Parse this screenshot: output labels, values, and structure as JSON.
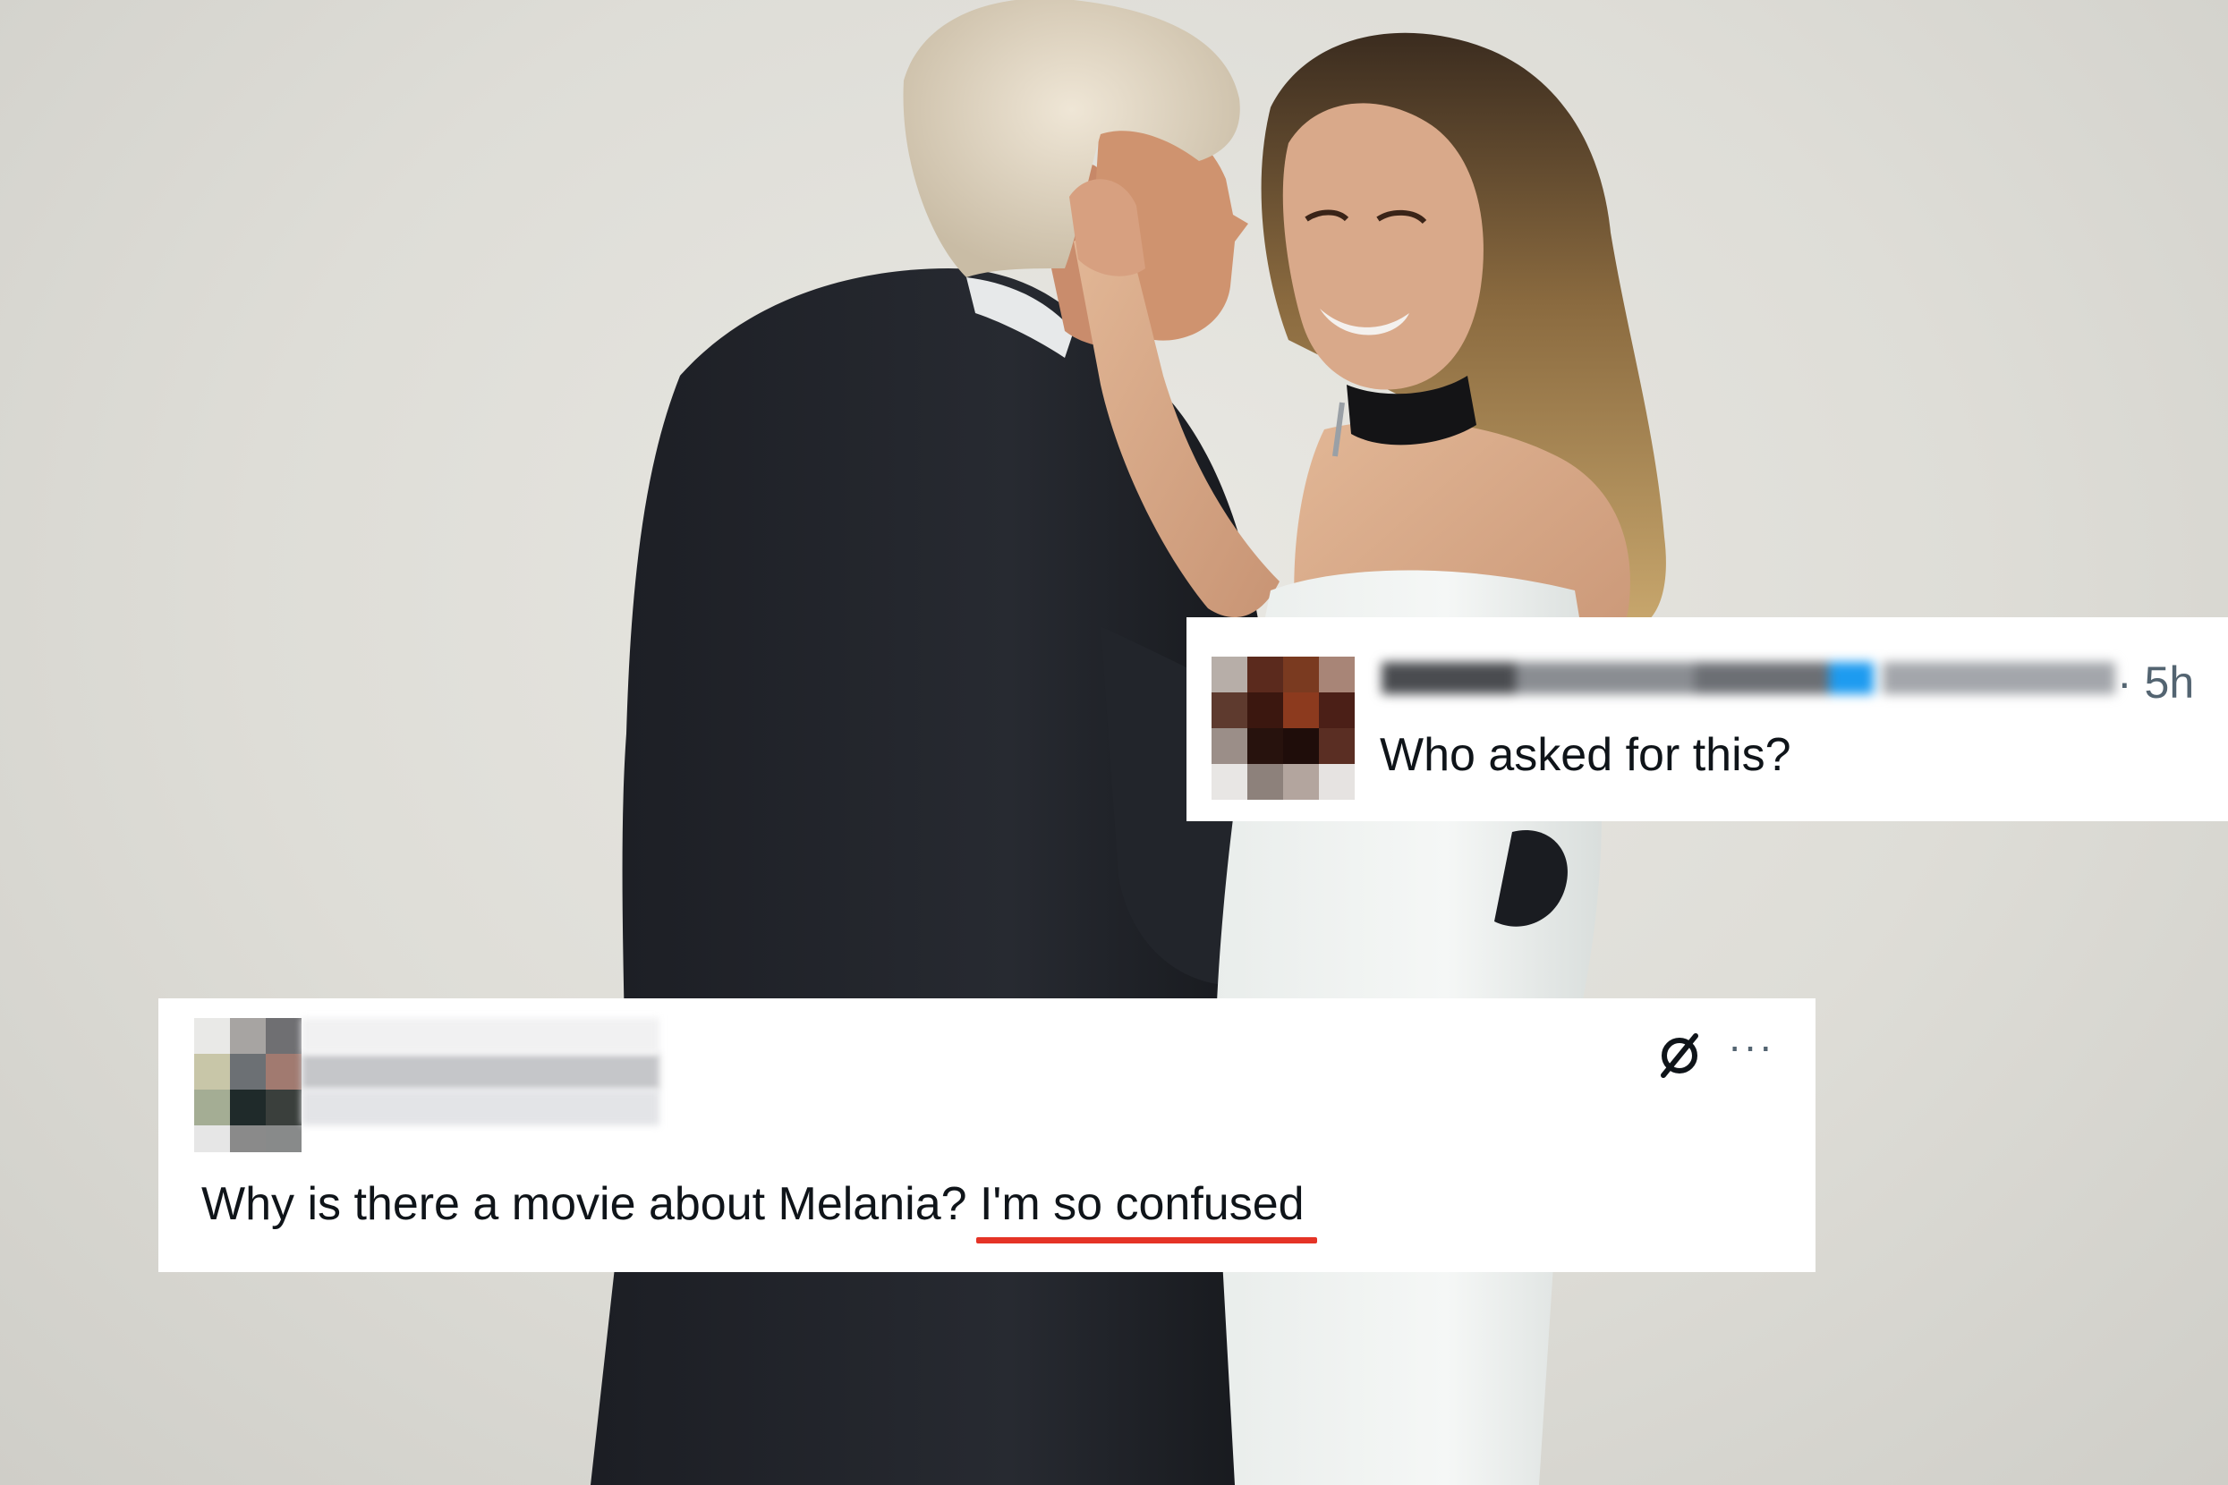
{
  "top_reply": {
    "timestamp": "· 5h",
    "text": "Who asked for this?",
    "avatar_icon": "pixelated-avatar",
    "verified_icon": "verified-badge-icon"
  },
  "bottom_reply": {
    "text_lead": "Why is there a movie about Melania? ",
    "text_highlight": "I'm so confused",
    "highlight_color": "#e53326",
    "actions": {
      "grok_icon": "slashed-circle-icon",
      "more_label": "···"
    }
  },
  "colors": {
    "background": "#dedcd6",
    "card": "#ffffff",
    "text": "#0f1419",
    "muted_text": "#536471"
  }
}
